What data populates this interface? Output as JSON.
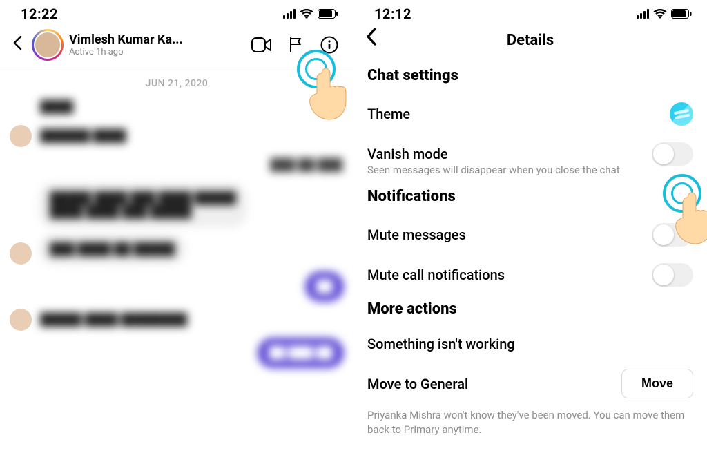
{
  "left": {
    "status_time": "12:22",
    "chat": {
      "name": "Vimlesh Kumar Ka...",
      "active": "Active 1h ago",
      "date_sep": "JUN 21, 2020"
    }
  },
  "right": {
    "status_time": "12:12",
    "title": "Details",
    "sections": {
      "chat_settings_h": "Chat settings",
      "theme_label": "Theme",
      "vanish_label": "Vanish mode",
      "vanish_sub": "Seen messages will disappear when you close the chat",
      "notifications_h": "Notifications",
      "mute_msg_label": "Mute messages",
      "mute_call_label": "Mute call notifications",
      "more_actions_h": "More actions",
      "not_working_label": "Something isn't working",
      "move_general_label": "Move to General",
      "move_btn": "Move",
      "move_footnote": "Priyanka Mishra won't know they've been moved. You can move them back to Primary anytime."
    }
  }
}
